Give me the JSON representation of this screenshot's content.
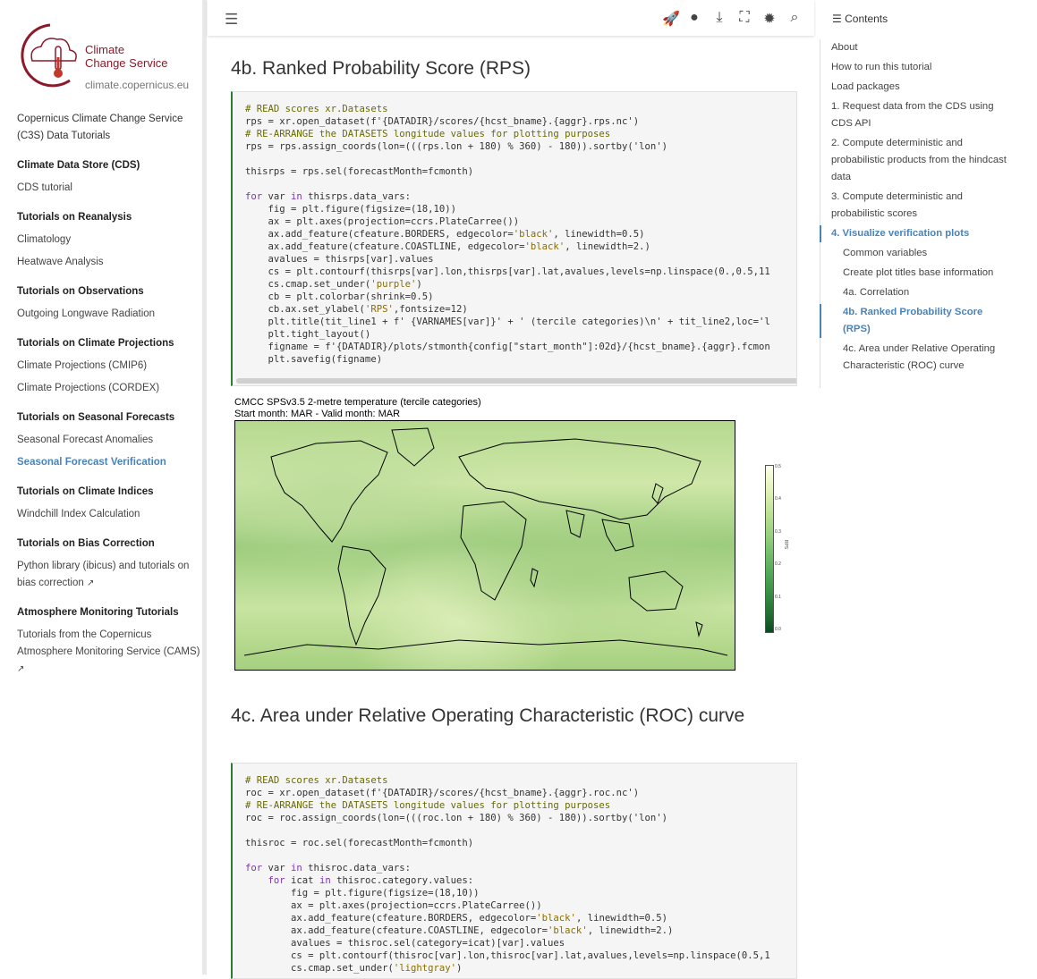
{
  "sidebar": {
    "logo_line1": "Climate",
    "logo_line2": "Change Service",
    "logo_url": "climate.copernicus.eu",
    "title": "Copernicus Climate Change Service (C3S) Data Tutorials",
    "sections": [
      {
        "heading": "Climate Data Store (CDS)",
        "items": [
          "CDS tutorial"
        ]
      },
      {
        "heading": "Tutorials on Reanalysis",
        "items": [
          "Climatology",
          "Heatwave Analysis"
        ]
      },
      {
        "heading": "Tutorials on Observations",
        "items": [
          "Outgoing Longwave Radiation"
        ]
      },
      {
        "heading": "Tutorials on Climate Projections",
        "items": [
          "Climate Projections (CMIP6)",
          "Climate Projections (CORDEX)"
        ]
      },
      {
        "heading": "Tutorials on Seasonal Forecasts",
        "items": [
          "Seasonal Forecast Anomalies",
          "Seasonal Forecast Verification"
        ]
      },
      {
        "heading": "Tutorials on Climate Indices",
        "items": [
          "Windchill Index Calculation"
        ]
      },
      {
        "heading": "Tutorials on Bias Correction",
        "items": [
          "Python library (ibicus) and tutorials on bias correction"
        ]
      },
      {
        "heading": "Atmosphere Monitoring Tutorials",
        "items": [
          "Tutorials from the Copernicus Atmosphere Monitoring Service (CAMS)"
        ]
      }
    ],
    "active_item": "Seasonal Forecast Verification"
  },
  "topbar": {
    "icons": [
      "menu-icon",
      "rocket-icon",
      "github-icon",
      "download-icon",
      "fullscreen-icon",
      "theme-icon",
      "search-icon"
    ]
  },
  "main": {
    "h_rps": "4b. Ranked Probability Score (RPS)",
    "h_roc": "4c. Area under Relative Operating Characteristic (ROC) curve",
    "figure_title_1": "CMCC SPSv3.5 2-metre temperature (tercile categories)",
    "figure_title_2": "Start month: MAR - Valid month: MAR",
    "colorbar_label": "RPS",
    "colorbar_ticks": [
      "0.5",
      "0.4",
      "0.3",
      "0.2",
      "0.1",
      "0.0"
    ]
  },
  "toc": {
    "heading": "Contents",
    "items": [
      {
        "label": "About",
        "level": 1
      },
      {
        "label": "How to run this tutorial",
        "level": 1
      },
      {
        "label": "Load packages",
        "level": 1
      },
      {
        "label": "1. Request data from the CDS using CDS API",
        "level": 1
      },
      {
        "label": "2. Compute deterministic and probabilistic products from the hindcast data",
        "level": 1
      },
      {
        "label": "3. Compute deterministic and probabilistic scores",
        "level": 1
      },
      {
        "label": "4. Visualize verification plots",
        "level": 1
      },
      {
        "label": "Common variables",
        "level": 2
      },
      {
        "label": "Create plot titles base information",
        "level": 2
      },
      {
        "label": "4a. Correlation",
        "level": 2
      },
      {
        "label": "4b. Ranked Probability Score (RPS)",
        "level": 2
      },
      {
        "label": "4c. Area under Relative Operating Characteristic (ROC) curve",
        "level": 2
      }
    ]
  }
}
